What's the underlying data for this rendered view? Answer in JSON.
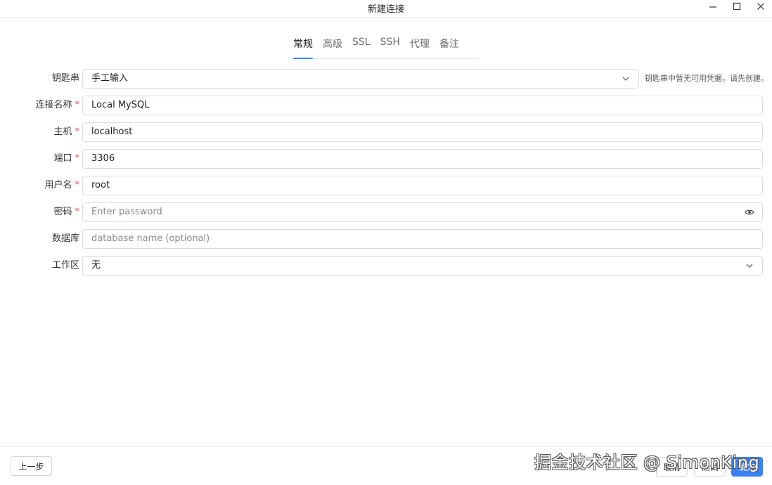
{
  "window": {
    "title": "新建连接",
    "controls": [
      "minimize-icon",
      "maximize-icon",
      "close-icon"
    ]
  },
  "tabs": [
    {
      "label": "常规",
      "active": true
    },
    {
      "label": "高级",
      "active": false
    },
    {
      "label": "SSL",
      "active": false
    },
    {
      "label": "SSH",
      "active": false
    },
    {
      "label": "代理",
      "active": false
    },
    {
      "label": "备注",
      "active": false
    }
  ],
  "form": {
    "keyring": {
      "label": "钥匙串",
      "value": "手工输入",
      "hint": "钥匙串中暂无可用凭据，请先创建。",
      "icon": "chevron-down-icon"
    },
    "name": {
      "label": "连接名称",
      "required_mark": "*",
      "value": "Local MySQL"
    },
    "host": {
      "label": "主机",
      "required_mark": "*",
      "value": "localhost"
    },
    "port": {
      "label": "端口",
      "required_mark": "*",
      "value": "3306"
    },
    "username": {
      "label": "用户名",
      "required_mark": "*",
      "value": "root"
    },
    "password": {
      "label": "密码",
      "required_mark": "*",
      "value": "",
      "placeholder": "Enter password",
      "icon": "eye-icon"
    },
    "database": {
      "label": "数据库",
      "value": "",
      "placeholder": "database name (optional)"
    },
    "workspace": {
      "label": "工作区",
      "value": "无",
      "icon": "chevron-down-icon"
    }
  },
  "footer": {
    "back_label": "上一步",
    "cancel_label": "取消",
    "test_label": "测试",
    "confirm_label": "确定"
  },
  "watermark": "掘金技术社区 @ SimonKing",
  "colors": {
    "accent": "#3b82f6",
    "required": "#e5484d"
  }
}
